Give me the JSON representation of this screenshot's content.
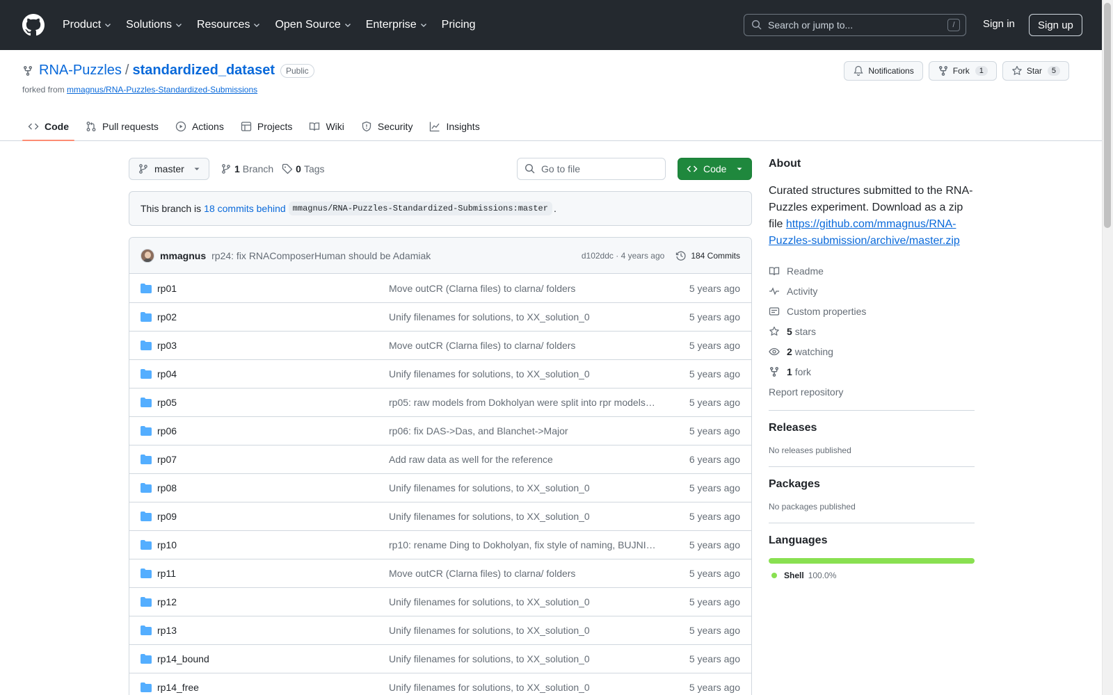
{
  "header": {
    "nav": [
      "Product",
      "Solutions",
      "Resources",
      "Open Source",
      "Enterprise",
      "Pricing"
    ],
    "search_placeholder": "Search or jump to...",
    "search_key": "/",
    "sign_in": "Sign in",
    "sign_up": "Sign up"
  },
  "repo": {
    "owner": "RNA-Puzzles",
    "separator": "/",
    "name": "standardized_dataset",
    "visibility": "Public",
    "forked_prefix": "forked from",
    "forked_from": "mmagnus/RNA-Puzzles-Standardized-Submissions",
    "notifications_label": "Notifications",
    "fork_label": "Fork",
    "fork_count": "1",
    "star_label": "Star",
    "star_count": "5"
  },
  "tabs": [
    {
      "label": "Code",
      "icon": "code-icon",
      "active": true
    },
    {
      "label": "Pull requests",
      "icon": "pull-request-icon"
    },
    {
      "label": "Actions",
      "icon": "play-icon"
    },
    {
      "label": "Projects",
      "icon": "table-icon"
    },
    {
      "label": "Wiki",
      "icon": "book-icon"
    },
    {
      "label": "Security",
      "icon": "shield-icon"
    },
    {
      "label": "Insights",
      "icon": "graph-icon"
    }
  ],
  "toolbar": {
    "branch": "master",
    "branch_count": "1",
    "branch_label": "Branch",
    "tags_count": "0",
    "tags_label": "Tags",
    "goto_placeholder": "Go to file",
    "code_button": "Code"
  },
  "behind": {
    "prefix": "This branch is",
    "link": "18 commits behind",
    "ref": "mmagnus/RNA-Puzzles-Standardized-Submissions:master",
    "suffix": "."
  },
  "last_commit": {
    "author": "mmagnus",
    "message": "rp24: fix RNAComposerHuman should be Adamiak",
    "hash": "d102ddc",
    "dot": "·",
    "age": "4 years ago",
    "commits": "184 Commits"
  },
  "files": [
    {
      "name": "rp01",
      "message": "Move outCR (Clarna files) to clarna/ folders",
      "age": "5 years ago"
    },
    {
      "name": "rp02",
      "message": "Unify filenames for solutions, to XX_solution_0",
      "age": "5 years ago"
    },
    {
      "name": "rp03",
      "message": "Move outCR (Clarna files) to clarna/ folders",
      "age": "5 years ago"
    },
    {
      "name": "rp04",
      "message": "Unify filenames for solutions, to XX_solution_0",
      "age": "5 years ago"
    },
    {
      "name": "rp05",
      "message": "rp05: raw models from Dokholyan were split into rpr models…",
      "age": "5 years ago"
    },
    {
      "name": "rp06",
      "message": "rp06: fix DAS->Das, and Blanchet->Major",
      "age": "5 years ago"
    },
    {
      "name": "rp07",
      "message": "Add raw data as well for the reference",
      "age": "6 years ago"
    },
    {
      "name": "rp08",
      "message": "Unify filenames for solutions, to XX_solution_0",
      "age": "5 years ago"
    },
    {
      "name": "rp09",
      "message": "Unify filenames for solutions, to XX_solution_0",
      "age": "5 years ago"
    },
    {
      "name": "rp10",
      "message": "rp10: rename Ding to Dokholyan, fix style of naming, BUJNI…",
      "age": "5 years ago"
    },
    {
      "name": "rp11",
      "message": "Move outCR (Clarna files) to clarna/ folders",
      "age": "5 years ago"
    },
    {
      "name": "rp12",
      "message": "Unify filenames for solutions, to XX_solution_0",
      "age": "5 years ago"
    },
    {
      "name": "rp13",
      "message": "Unify filenames for solutions, to XX_solution_0",
      "age": "5 years ago"
    },
    {
      "name": "rp14_bound",
      "message": "Unify filenames for solutions, to XX_solution_0",
      "age": "5 years ago"
    },
    {
      "name": "rp14_free",
      "message": "Unify filenames for solutions, to XX_solution_0",
      "age": "5 years ago"
    }
  ],
  "about": {
    "title": "About",
    "description": "Curated structures submitted to the RNA-Puzzles experiment. Download as a zip file",
    "link": "https://github.com/mmagnus/RNA-Puzzles-submission/archive/master.zip",
    "readme": "Readme",
    "activity": "Activity",
    "custom_properties": "Custom properties",
    "stars_count": "5",
    "stars_label": "stars",
    "watching_count": "2",
    "watching_label": "watching",
    "fork_count": "1",
    "fork_label": "fork",
    "report": "Report repository"
  },
  "releases": {
    "title": "Releases",
    "empty": "No releases published"
  },
  "packages": {
    "title": "Packages",
    "empty": "No packages published"
  },
  "languages": {
    "title": "Languages",
    "name": "Shell",
    "percent": "100.0%",
    "color": "#89e051"
  },
  "colors": {
    "header_bg": "#24292f",
    "link": "#0969da",
    "code_button": "#1f883d",
    "tab_underline": "#fd8c73",
    "folder": "#54aeff"
  }
}
